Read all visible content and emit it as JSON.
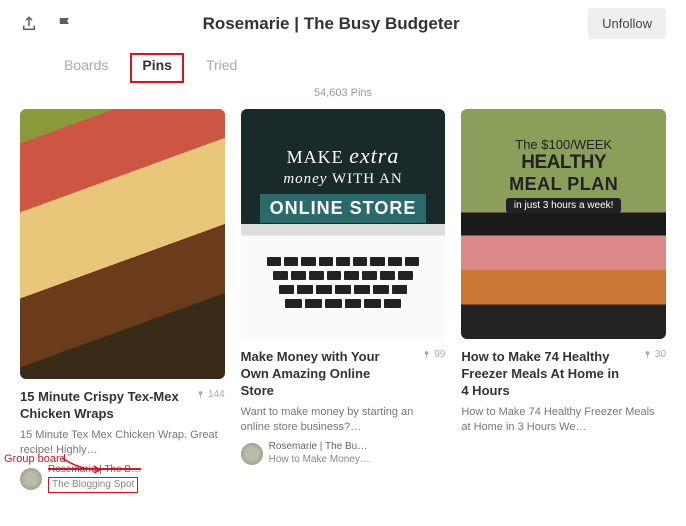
{
  "header": {
    "title": "Rosemarie | The Busy Budgeter",
    "unfollow": "Unfollow"
  },
  "tabs": {
    "boards": "Boards",
    "pins": "Pins",
    "tried": "Tried"
  },
  "count": "54,603 Pins",
  "pins": [
    {
      "title": "15 Minute Crispy Tex-Mex Chicken Wraps",
      "repins": "144",
      "desc": "15 Minute Tex Mex Chicken Wrap. Great recipe! Highly…",
      "attrib_l1": "Rosemarie | The B…",
      "attrib_l2": "The Blogging Spot"
    },
    {
      "title": "Make Money with Your Own Amazing Online Store",
      "repins": "99",
      "desc": "Want to make money by starting an online store business?…",
      "attrib_l1": "Rosemarie | The Bu…",
      "attrib_l2": "How to Make Money…",
      "overlay": {
        "a": "MAKE",
        "b": "extra",
        "c": "money",
        "d": "WITH AN",
        "e": "ONLINE STORE"
      }
    },
    {
      "title": "How to Make 74 Healthy Freezer Meals At Home in 4 Hours",
      "repins": "30",
      "desc": "How to Make 74 Healthy Freezer Meals at Home in 3 Hours We…",
      "overlay": {
        "a": "The $100/WEEK",
        "b": "HEALTHY",
        "c": "MEAL PLAN",
        "d": "in just 3 hours a week!"
      }
    }
  ],
  "annotation": "Group board"
}
